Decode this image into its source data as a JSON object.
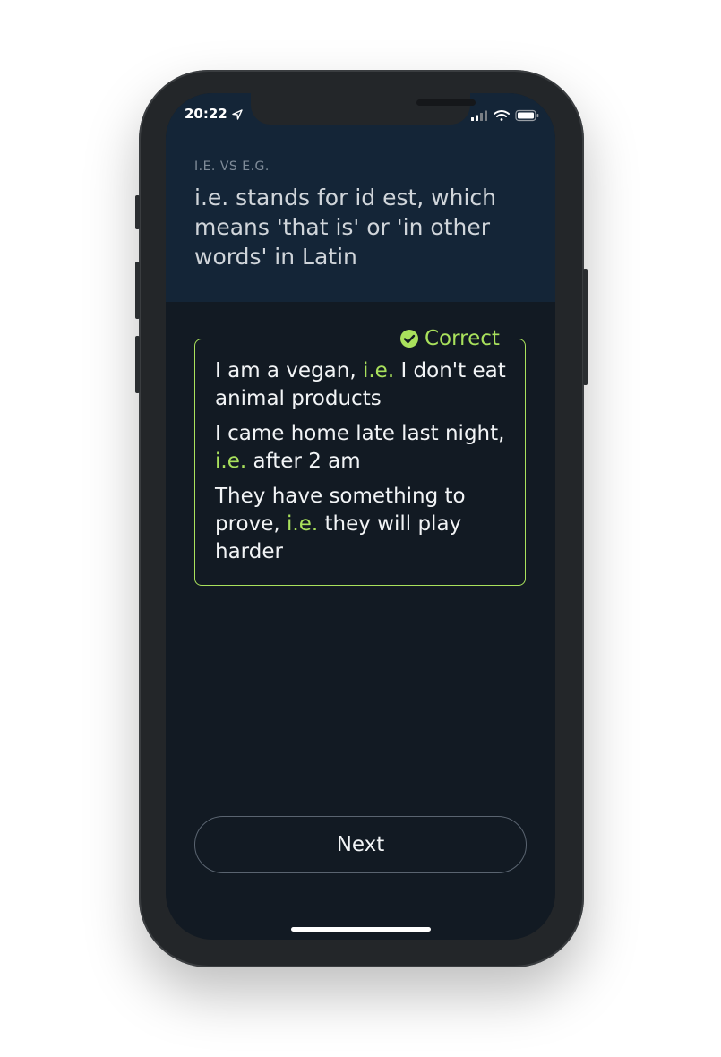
{
  "status": {
    "time": "20:22"
  },
  "header": {
    "topic": "I.E. VS E.G.",
    "lesson": "i.e. stands for id est, which means 'that is' or 'in other words' in Latin"
  },
  "card": {
    "badge": "Correct",
    "accent_color": "#a9e15c",
    "examples": [
      {
        "before": "I am a vegan, ",
        "highlight": "i.e.",
        "after": " I don't eat animal products"
      },
      {
        "before": "I came home late last night, ",
        "highlight": "i.e.",
        "after": " after 2 am"
      },
      {
        "before": "They have something to prove, ",
        "highlight": "i.e.",
        "after": " they will play harder"
      }
    ]
  },
  "next_button": {
    "label": "Next"
  }
}
